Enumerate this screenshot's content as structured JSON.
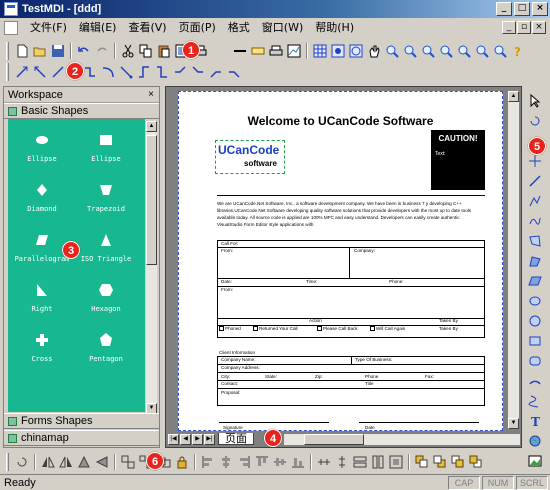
{
  "window": {
    "title": "TestMDI - [ddd]"
  },
  "menu": [
    "文件(F)",
    "编辑(E)",
    "查看(V)",
    "页面(P)",
    "格式",
    "窗口(W)",
    "帮助(H)"
  ],
  "badges": [
    "1",
    "2",
    "3",
    "4",
    "5",
    "6"
  ],
  "workspace": {
    "title": "Workspace",
    "categories": [
      "Basic Shapes",
      "Forms Shapes",
      "chinamap"
    ],
    "shapes": [
      "Ellipse",
      "Ellipse",
      "Diamond",
      "Trapezoid",
      "Parallelogram",
      "ISO Triangle",
      "Right",
      "Hexagon",
      "Cross",
      "Pentagon"
    ]
  },
  "document": {
    "title": "Welcome to UCanCode Software",
    "logo_main": "UCanCode",
    "logo_sub": "software",
    "caution_title": "CAUTION!",
    "caution_text": "Text:",
    "intro": "We are UCanCode.Net Software, Inc., a software development company. We have been in business 7 y developing C++ libraries.UCanCode.Net Software developing quality software solutions that provide developers with the most up to date tools available today. All source code is applied are 100% MFC and easy understand. Developers can easily create authentic VisualStudio Form Editor style applications with",
    "form": {
      "call_for": "Call For:",
      "from": "From:",
      "company": "Company:",
      "date": "Date:",
      "time": "Time:",
      "phone": "Phone:",
      "from2": "From:",
      "action": "Action",
      "taken_by": "Taken By",
      "phoned": "Phoned",
      "returned": "Returned Your Call",
      "please_call": "Please Call Back",
      "will_call": "Will Call Again",
      "taken_by2": "Taken By",
      "client_info": "Client Information",
      "company_name": "Company Name:",
      "type_business": "Type Of Business:",
      "company_address": "Company Address:",
      "city": "City:",
      "state": "State:",
      "zip": "Zip:",
      "phone2": "Phone",
      "fax": "Fax:",
      "contact": "Contact:",
      "title": "Title",
      "proposal": "Proposal:",
      "signature": "Signature",
      "date2": "Date"
    },
    "page_tab": "页面"
  },
  "status": {
    "text": "Ready",
    "indicators": [
      "CAP",
      "NUM",
      "SCRL"
    ]
  },
  "colors": {
    "workspace_bg": "#17b88f",
    "badge": "#e8241c"
  }
}
